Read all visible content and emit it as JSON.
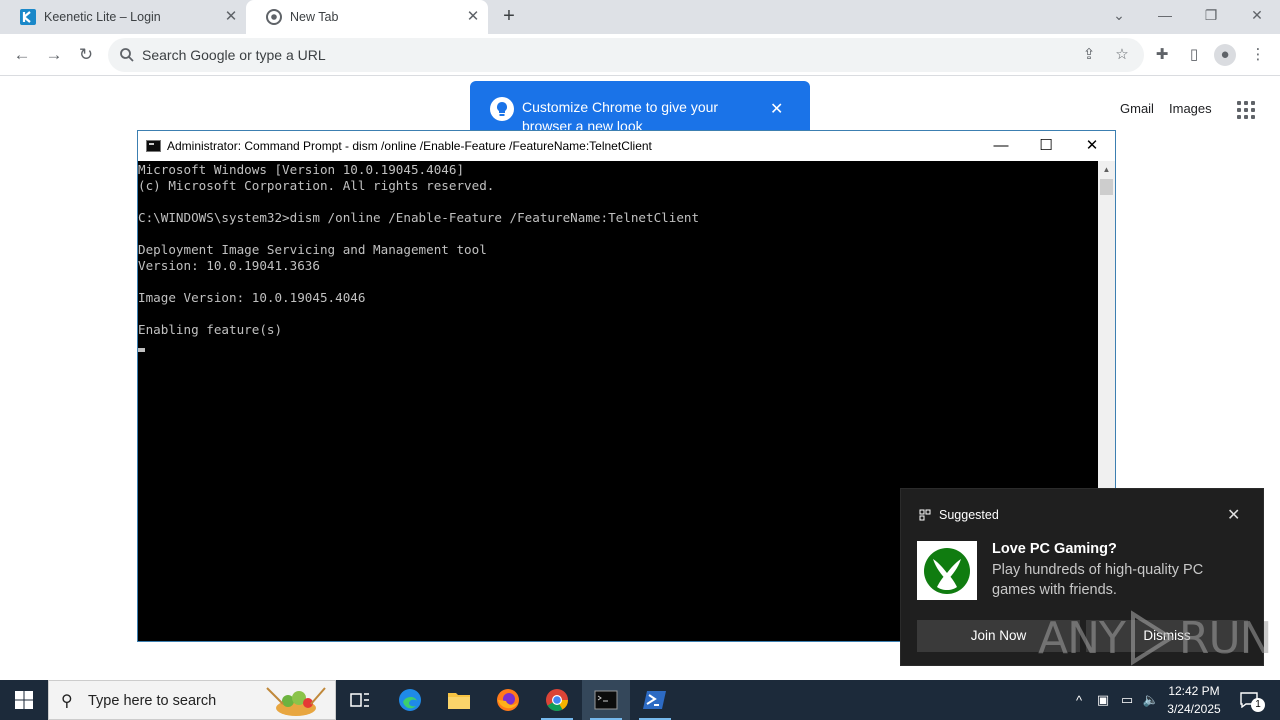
{
  "browser": {
    "tabs": [
      {
        "label": "Keenetic Lite – Login",
        "active": false
      },
      {
        "label": "New Tab",
        "active": true
      }
    ],
    "omnibox": {
      "placeholder": "Search Google or type a URL"
    },
    "links": {
      "gmail": "Gmail",
      "images": "Images"
    },
    "customize_bubble": {
      "text": "Customize Chrome to give your browser a new look"
    }
  },
  "cmd": {
    "title": "Administrator: Command Prompt - dism  /online /Enable-Feature /FeatureName:TelnetClient",
    "lines": [
      "Microsoft Windows [Version 10.0.19045.4046]",
      "(c) Microsoft Corporation. All rights reserved.",
      "",
      "C:\\WINDOWS\\system32>dism /online /Enable-Feature /FeatureName:TelnetClient",
      "",
      "Deployment Image Servicing and Management tool",
      "Version: 10.0.19041.3636",
      "",
      "Image Version: 10.0.19045.4046",
      "",
      "Enabling feature(s)"
    ]
  },
  "notification": {
    "header": "Suggested",
    "heading": "Love PC Gaming?",
    "body": "Play hundreds of high-quality PC games with friends.",
    "join_label": "Join Now",
    "dismiss_label": "Dismiss"
  },
  "watermark": {
    "left": "ANY",
    "right": "RUN"
  },
  "taskbar": {
    "search_placeholder": "Type here to search",
    "time": "12:42 PM",
    "date": "3/24/2025",
    "notification_count": "1"
  }
}
